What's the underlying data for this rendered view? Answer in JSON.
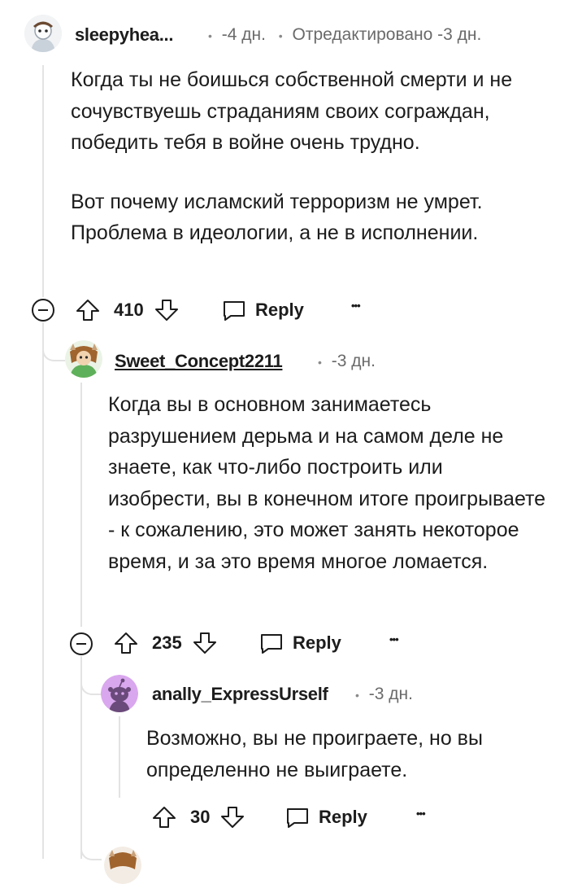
{
  "comments": [
    {
      "username": "sleepyhea...",
      "time": "-4 дн.",
      "edited": "Отредактировано -3 дн.",
      "paragraphs": [
        "Когда ты не боишься собственной смерти и не сочувствуешь страданиям своих сограждан, победить тебя в войне очень трудно.",
        "Вот почему исламский терроризм не умрет. Проблема в идеологии, а не в исполнении."
      ],
      "votes": "410",
      "reply_label": "Reply"
    },
    {
      "username": "Sweet_Concept2211",
      "time": "-3 дн.",
      "paragraphs": [
        "Когда вы в основном занимаетесь разрушением дерьма и на самом деле не знаете, как что-либо построить или изобрести, вы в конечном итоге проигрываете - к сожалению, это может занять некоторое время, и за это время многое ломается."
      ],
      "votes": "235",
      "reply_label": "Reply"
    },
    {
      "username": "anally_ExpressUrself",
      "time": "-3 дн.",
      "paragraphs": [
        "Возможно, вы не проиграете, но вы определенно не выиграете."
      ],
      "votes": "30",
      "reply_label": "Reply"
    }
  ],
  "separator": "•",
  "more_label": "•••",
  "colors": {
    "text": "#1c1c1c",
    "meta": "#6a6a6a",
    "thread_line": "#e3e3e3",
    "snoo_purple": "#d9a7ee"
  }
}
